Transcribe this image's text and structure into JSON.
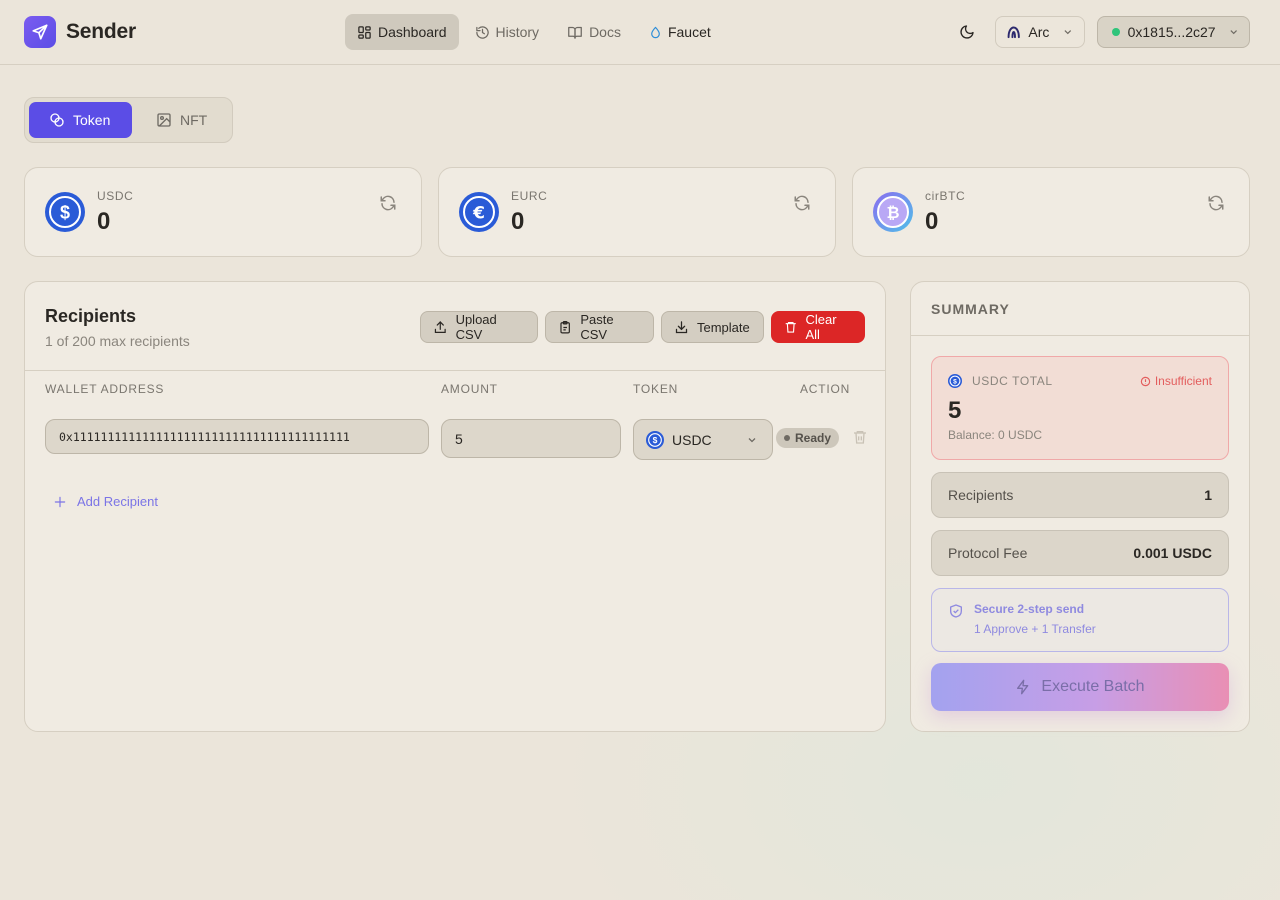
{
  "app": {
    "brand": "Sender",
    "nav": [
      {
        "label": "Dashboard",
        "icon": "grid-icon",
        "active": true
      },
      {
        "label": "History",
        "icon": "history-icon"
      },
      {
        "label": "Docs",
        "icon": "book-icon"
      },
      {
        "label": "Faucet",
        "icon": "droplet-icon"
      }
    ],
    "chain": "Arc",
    "wallet": "0x1815...2c27"
  },
  "mode_tabs": [
    {
      "label": "Token",
      "active": true
    },
    {
      "label": "NFT",
      "active": false
    }
  ],
  "balances": [
    {
      "symbol": "USDC",
      "value": "0",
      "icon": "usdc-icon"
    },
    {
      "symbol": "EURC",
      "value": "0",
      "icon": "eurc-icon"
    },
    {
      "symbol": "cirBTC",
      "value": "0",
      "icon": "btc-icon"
    }
  ],
  "recipients": {
    "title": "Recipients",
    "subtitle": "1 of 200 max recipients",
    "buttons": {
      "upload": "Upload CSV",
      "paste": "Paste CSV",
      "template": "Template",
      "clear": "Clear All"
    },
    "columns": [
      "WALLET ADDRESS",
      "AMOUNT",
      "TOKEN",
      "ACTION"
    ],
    "rows": [
      {
        "address": "0x1111111111111111111111111111111111111111",
        "amount": "5",
        "token": "USDC",
        "status": "Ready"
      }
    ],
    "add_label": "Add Recipient"
  },
  "summary": {
    "title": "SUMMARY",
    "total_label": "USDC TOTAL",
    "insufficient": "Insufficient",
    "total_value": "5",
    "balance_text": "Balance: 0 USDC",
    "recipients_label": "Recipients",
    "recipients_value": "1",
    "fee_label": "Protocol Fee",
    "fee_value": "0.001 USDC",
    "secure_title": "Secure 2-step send",
    "secure_sub": "1 Approve + 1 Transfer",
    "execute_label": "Execute Batch"
  },
  "colors": {
    "accent": "#5b4de6",
    "danger": "#dc2626",
    "usdc": "#2a5bd7",
    "btc_gradient": [
      "#8b6cf0",
      "#4fc0e8"
    ]
  }
}
